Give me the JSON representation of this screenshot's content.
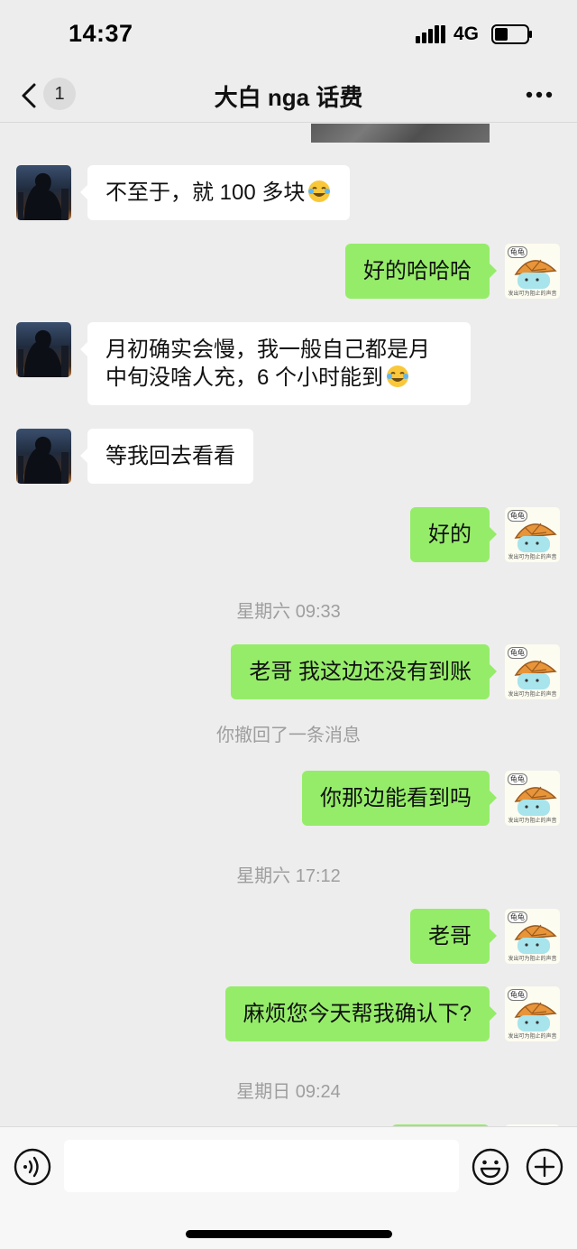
{
  "status_bar": {
    "time": "14:37",
    "network": "4G"
  },
  "nav": {
    "unread_count": "1",
    "title": "大白 nga 话费"
  },
  "messages": [
    {
      "side": "in",
      "text": "不至于，就 100 多块",
      "emoji": "rofl"
    },
    {
      "side": "out",
      "text": "好的哈哈哈"
    },
    {
      "side": "in",
      "line1": "月初确实会慢，我一般自己都是月",
      "line2": "中旬没啥人充，6 个小时能到",
      "emoji": "rofl"
    },
    {
      "side": "in",
      "text": "等我回去看看"
    },
    {
      "side": "out",
      "text": "好的"
    },
    {
      "side": "out",
      "text": "老哥 我这边还没有到账"
    },
    {
      "side": "out",
      "text": "你那边能看到吗"
    },
    {
      "side": "out",
      "text": "老哥"
    },
    {
      "side": "out",
      "text": "麻烦您今天帮我确认下?"
    }
  ],
  "timestamps": [
    "星期六 09:33",
    "星期六 17:12",
    "星期日 09:24"
  ],
  "system_notes": {
    "recalled": "你撤回了一条消息"
  },
  "avatar_out": {
    "tag": "龟龟",
    "caption": "发出可为阻止的声音"
  },
  "input": {
    "value": ""
  },
  "colors": {
    "background": "#ededed",
    "bubble_out": "#95ec69",
    "bubble_in": "#ffffff",
    "timestamp_text": "#9e9e9e"
  }
}
